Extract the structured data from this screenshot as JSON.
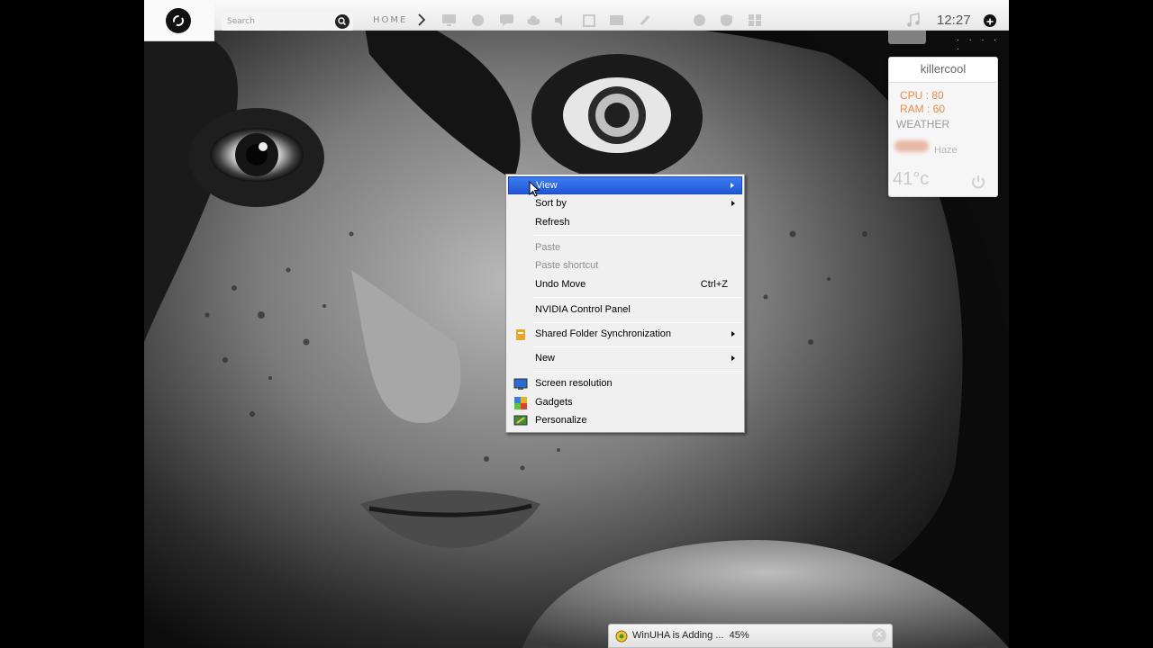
{
  "topbar": {
    "search_placeholder": "Search",
    "home_label": "HOME",
    "clock": "12:27",
    "dots": ". . . . ."
  },
  "widget": {
    "user": "killercool",
    "cpu": "CPU : 80",
    "ram": "RAM : 60",
    "weather_label": "WEATHER",
    "condition": "Haze",
    "temperature": "41°c",
    "accent_color": "#ef8a4c"
  },
  "context_menu": {
    "items": [
      {
        "label": "View",
        "submenu": true,
        "highlighted": true
      },
      {
        "label": "Sort by",
        "submenu": true
      },
      {
        "label": "Refresh"
      },
      {
        "label": "Paste",
        "disabled": true
      },
      {
        "label": "Paste shortcut",
        "disabled": true
      },
      {
        "label": "Undo Move",
        "shortcut": "Ctrl+Z"
      },
      {
        "label": "NVIDIA Control Panel"
      },
      {
        "label": "Shared Folder Synchronization",
        "submenu": true,
        "icon": "sync-folder-icon"
      },
      {
        "label": "New",
        "submenu": true
      },
      {
        "label": "Screen resolution",
        "icon": "monitor-icon"
      },
      {
        "label": "Gadgets",
        "icon": "gadgets-icon"
      },
      {
        "label": "Personalize",
        "icon": "personalize-icon"
      }
    ],
    "highlight_color": "#2a66e0"
  },
  "toast": {
    "text": "WinUHA is Adding ...  45%",
    "progress": 45
  }
}
